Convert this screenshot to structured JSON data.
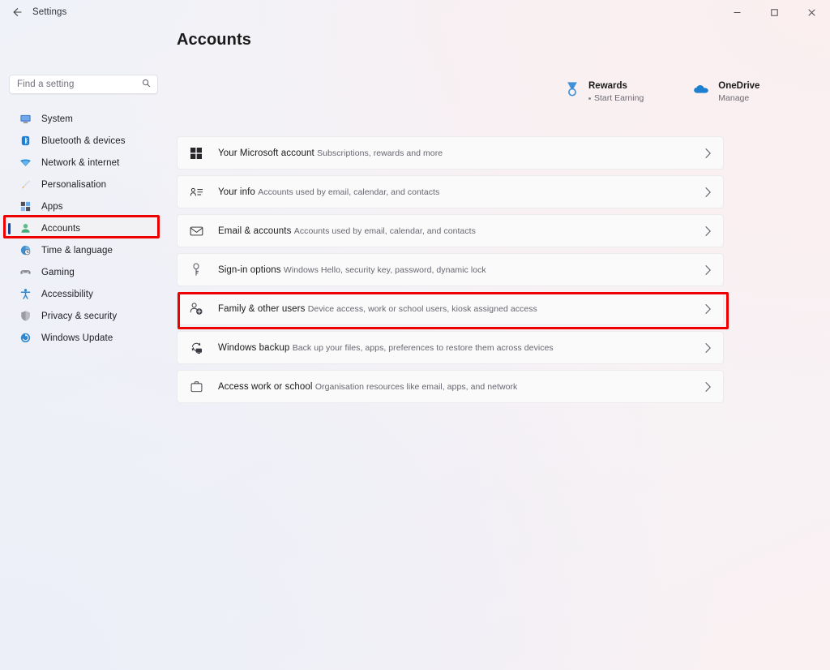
{
  "window": {
    "title": "Settings",
    "back_icon": "back-arrow-icon",
    "minimize_label": "–",
    "maximize_label": "☐",
    "close_label": "✕"
  },
  "search": {
    "placeholder": "Find a setting",
    "icon": "search-icon",
    "value": ""
  },
  "sidebar": {
    "items": [
      {
        "label": "System",
        "icon": "monitor-icon",
        "selected": false
      },
      {
        "label": "Bluetooth & devices",
        "icon": "bluetooth-icon",
        "selected": false
      },
      {
        "label": "Network & internet",
        "icon": "wifi-icon",
        "selected": false
      },
      {
        "label": "Personalisation",
        "icon": "paintbrush-icon",
        "selected": false
      },
      {
        "label": "Apps",
        "icon": "apps-grid-icon",
        "selected": false
      },
      {
        "label": "Accounts",
        "icon": "person-icon",
        "selected": true
      },
      {
        "label": "Time & language",
        "icon": "clock-globe-icon",
        "selected": false
      },
      {
        "label": "Gaming",
        "icon": "gamepad-icon",
        "selected": false
      },
      {
        "label": "Accessibility",
        "icon": "accessibility-icon",
        "selected": false
      },
      {
        "label": "Privacy & security",
        "icon": "shield-icon",
        "selected": false
      },
      {
        "label": "Windows Update",
        "icon": "update-icon",
        "selected": false
      }
    ]
  },
  "main": {
    "page_title": "Accounts",
    "shortcuts": [
      {
        "title": "Rewards",
        "subtitle": "Start Earning",
        "icon": "medal-icon",
        "has_dot": true
      },
      {
        "title": "OneDrive",
        "subtitle": "Manage",
        "icon": "cloud-icon",
        "has_dot": false
      }
    ],
    "rows": [
      {
        "title": "Your Microsoft account",
        "subtitle": "Subscriptions, rewards and more",
        "icon": "windows-logo-icon",
        "chevron": "chevron-right-icon",
        "highlighted": false
      },
      {
        "title": "Your info",
        "subtitle": "Accounts used by email, calendar, and contacts",
        "icon": "contact-card-icon",
        "chevron": "chevron-right-icon",
        "highlighted": false
      },
      {
        "title": "Email & accounts",
        "subtitle": "Accounts used by email, calendar, and contacts",
        "icon": "envelope-icon",
        "chevron": "chevron-right-icon",
        "highlighted": false
      },
      {
        "title": "Sign-in options",
        "subtitle": "Windows Hello, security key, password, dynamic lock",
        "icon": "key-icon",
        "chevron": "chevron-right-icon",
        "highlighted": false
      },
      {
        "title": "Family & other users",
        "subtitle": "Device access, work or school users, kiosk assigned access",
        "icon": "person-add-icon",
        "chevron": "chevron-right-icon",
        "highlighted": true
      },
      {
        "title": "Windows backup",
        "subtitle": "Back up your files, apps, preferences to restore them across devices",
        "icon": "backup-sync-icon",
        "chevron": "chevron-right-icon",
        "highlighted": false
      },
      {
        "title": "Access work or school",
        "subtitle": "Organisation resources like email, apps, and network",
        "icon": "briefcase-icon",
        "chevron": "chevron-right-icon",
        "highlighted": false
      }
    ]
  },
  "annotations": {
    "color": "#ef0000",
    "targets": [
      "sidebar-item-accounts",
      "row-family-and-other-users"
    ]
  },
  "colors": {
    "accent": "#1b3f8f",
    "annotation": "#ef0000",
    "card_bg": "#fafafb",
    "selected_nav_bg": "#f2f2f4"
  }
}
